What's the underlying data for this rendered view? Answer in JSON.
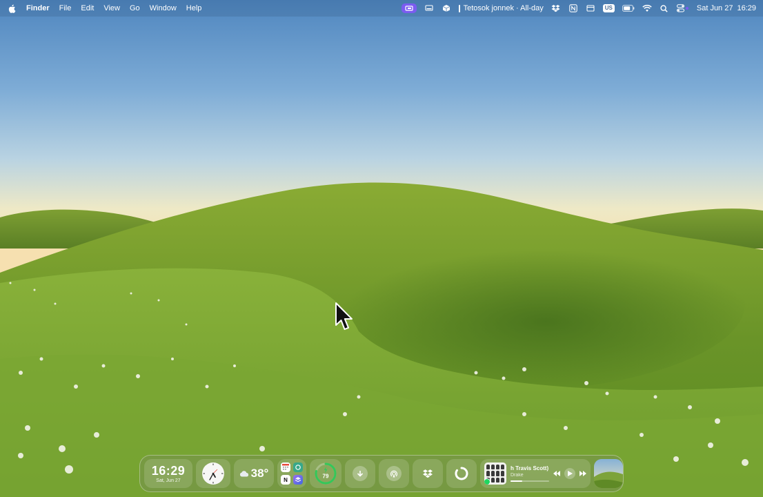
{
  "menubar": {
    "app_name": "Finder",
    "menus": [
      "File",
      "Edit",
      "View",
      "Go",
      "Window",
      "Help"
    ],
    "event_text": "Tetosok jonnek · All-day",
    "keyboard_layout": "US",
    "clock_day": "Sat Jun 27",
    "clock_time": "16:29",
    "accent_color": "#7b5cf0",
    "status_icons": [
      "screen-share-icon",
      "display-icon",
      "box-icon",
      "dropbox-icon",
      "notion-icon",
      "window-icon",
      "keyboard-layout-icon",
      "battery-icon",
      "wifi-icon",
      "search-icon",
      "control-center-icon"
    ]
  },
  "widgets": {
    "time": "16:29",
    "date": "Sat, Jun 27",
    "weather_temp": "38°",
    "weather_icon": "cloud-icon",
    "battery_level": "79",
    "battery_fraction": 0.79,
    "battery_color": "#34c759",
    "apps": [
      "calendar-icon",
      "chatgpt-icon",
      "notion-icon",
      "stack-icon"
    ],
    "notion_letter": "N",
    "tiles": [
      "download-icon",
      "airdrop-icon",
      "dropbox-icon",
      "loading-icon"
    ],
    "music": {
      "song": "h Travis Scott)",
      "artist": "Drake",
      "progress": 0.3
    }
  }
}
